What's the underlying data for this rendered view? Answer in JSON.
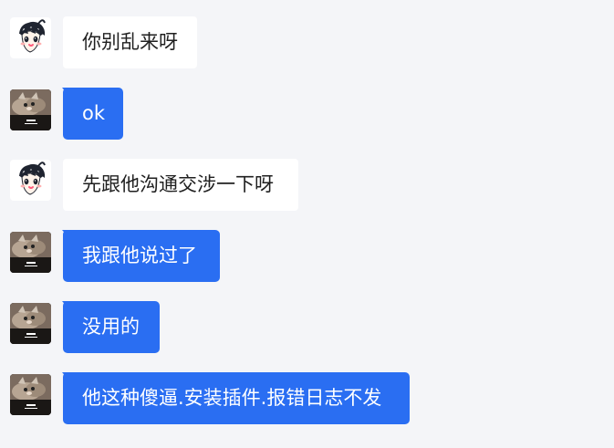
{
  "messages": [
    {
      "sender": "anime-avatar-user",
      "text": "你别乱来呀"
    },
    {
      "sender": "cat-avatar-user",
      "text": "ok"
    },
    {
      "sender": "anime-avatar-user",
      "text": "先跟他沟通交涉一下呀"
    },
    {
      "sender": "cat-avatar-user",
      "text": "我跟他说过了"
    },
    {
      "sender": "cat-avatar-user",
      "text": "没用的"
    },
    {
      "sender": "cat-avatar-user",
      "text": "他这种傻逼.安装插件.报错日志不发"
    }
  ],
  "colors": {
    "background": "#f4f5f8",
    "white_bubble": "#ffffff",
    "blue_bubble": "#2a6ef2",
    "white_text": "#1f1f1f",
    "blue_text": "#ffffff"
  },
  "avatar_icons": {
    "anime": "anime-boy-avatar-icon",
    "cat": "cat-photo-avatar-icon"
  }
}
